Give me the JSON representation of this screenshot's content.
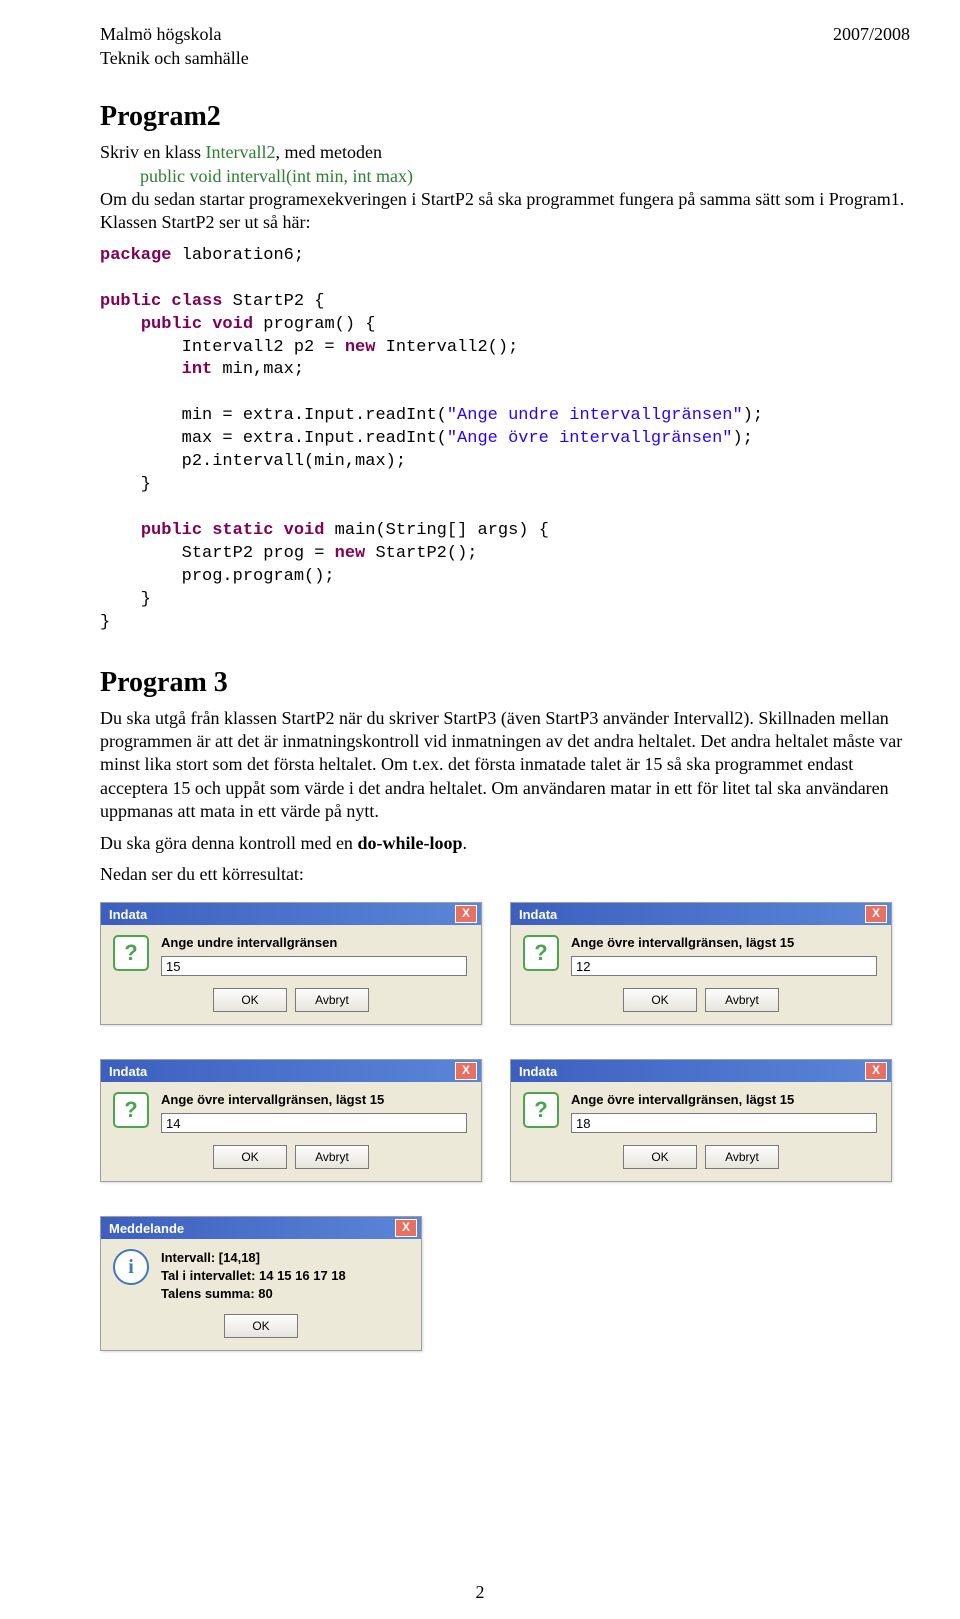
{
  "header": {
    "left1": "Malmö högskola",
    "left2": "Teknik och samhälle",
    "right": "2007/2008"
  },
  "program2": {
    "title": "Program2",
    "intro_line1": "Skriv en klass ",
    "intro_class": "Intervall2",
    "intro_line1b": ", med metoden",
    "intro_method": "public void intervall(int min, int max)",
    "intro_para": "Om du sedan startar programexekveringen i StartP2 så ska programmet fungera på samma sätt som i Program1. Klassen StartP2 ser ut så här:"
  },
  "code": {
    "kw_package": "package",
    "pkg": " laboration6;",
    "kw_public": "public",
    "kw_class": "class",
    "cls": " StartP2 {",
    "kw_void": "void",
    "m_program": " program() {",
    "line_p2": "        Intervall2 p2 = ",
    "kw_new": "new",
    "line_p2b": " Intervall2();",
    "kw_int": "int",
    "line_minmax": " min,max;",
    "line_min": "        min = extra.Input.readInt(",
    "str_undre": "\"Ange undre intervallgränsen\"",
    "line_close": ");",
    "line_max": "        max = extra.Input.readInt(",
    "str_ovre": "\"Ange övre intervallgränsen\"",
    "line_call": "        p2.intervall(min,max);",
    "line_cb": "    }",
    "kw_static": "static",
    "m_main": " main(String[] args) {",
    "line_prog": "        StartP2 prog = ",
    "line_progb": " StartP2();",
    "line_run": "        prog.program();",
    "line_cb2": "    }",
    "line_cb3": "}"
  },
  "program3": {
    "title": "Program 3",
    "para1": "Du ska utgå från klassen StartP2 när du skriver StartP3 (även StartP3 använder Intervall2). Skillnaden mellan programmen är att det är inmatningskontroll vid inmatningen av det andra heltalet. Det andra heltalet måste var minst lika stort som det första heltalet. Om t.ex. det första inmatade talet är 15 så ska programmet endast acceptera 15 och uppåt som värde i det andra heltalet. Om användaren matar in ett för litet tal ska användaren uppmanas att mata in ett värde på nytt.",
    "para2_a": "Du ska göra denna kontroll med en ",
    "para2_b": "do-while-loop",
    "para2_c": ".",
    "para3": "Nedan ser du ett körresultat:"
  },
  "dialogs": {
    "title_indata": "Indata",
    "title_meddelande": "Meddelande",
    "btn_ok": "OK",
    "btn_cancel": "Avbryt",
    "d1_prompt": "Ange undre intervallgränsen",
    "d1_value": "15",
    "d2_prompt": "Ange övre intervallgränsen, lägst 15",
    "d2_value": "12",
    "d3_prompt": "Ange övre intervallgränsen, lägst 15",
    "d3_value": "14",
    "d4_prompt": "Ange övre intervallgränsen, lägst 15",
    "d4_value": "18",
    "msg_line1": "Intervall: [14,18]",
    "msg_line2": "Tal i intervallet: 14 15 16 17 18",
    "msg_line3": "Talens summa: 80"
  },
  "page_number": "2",
  "icons": {
    "question": "?",
    "info": "i",
    "close": "X"
  }
}
